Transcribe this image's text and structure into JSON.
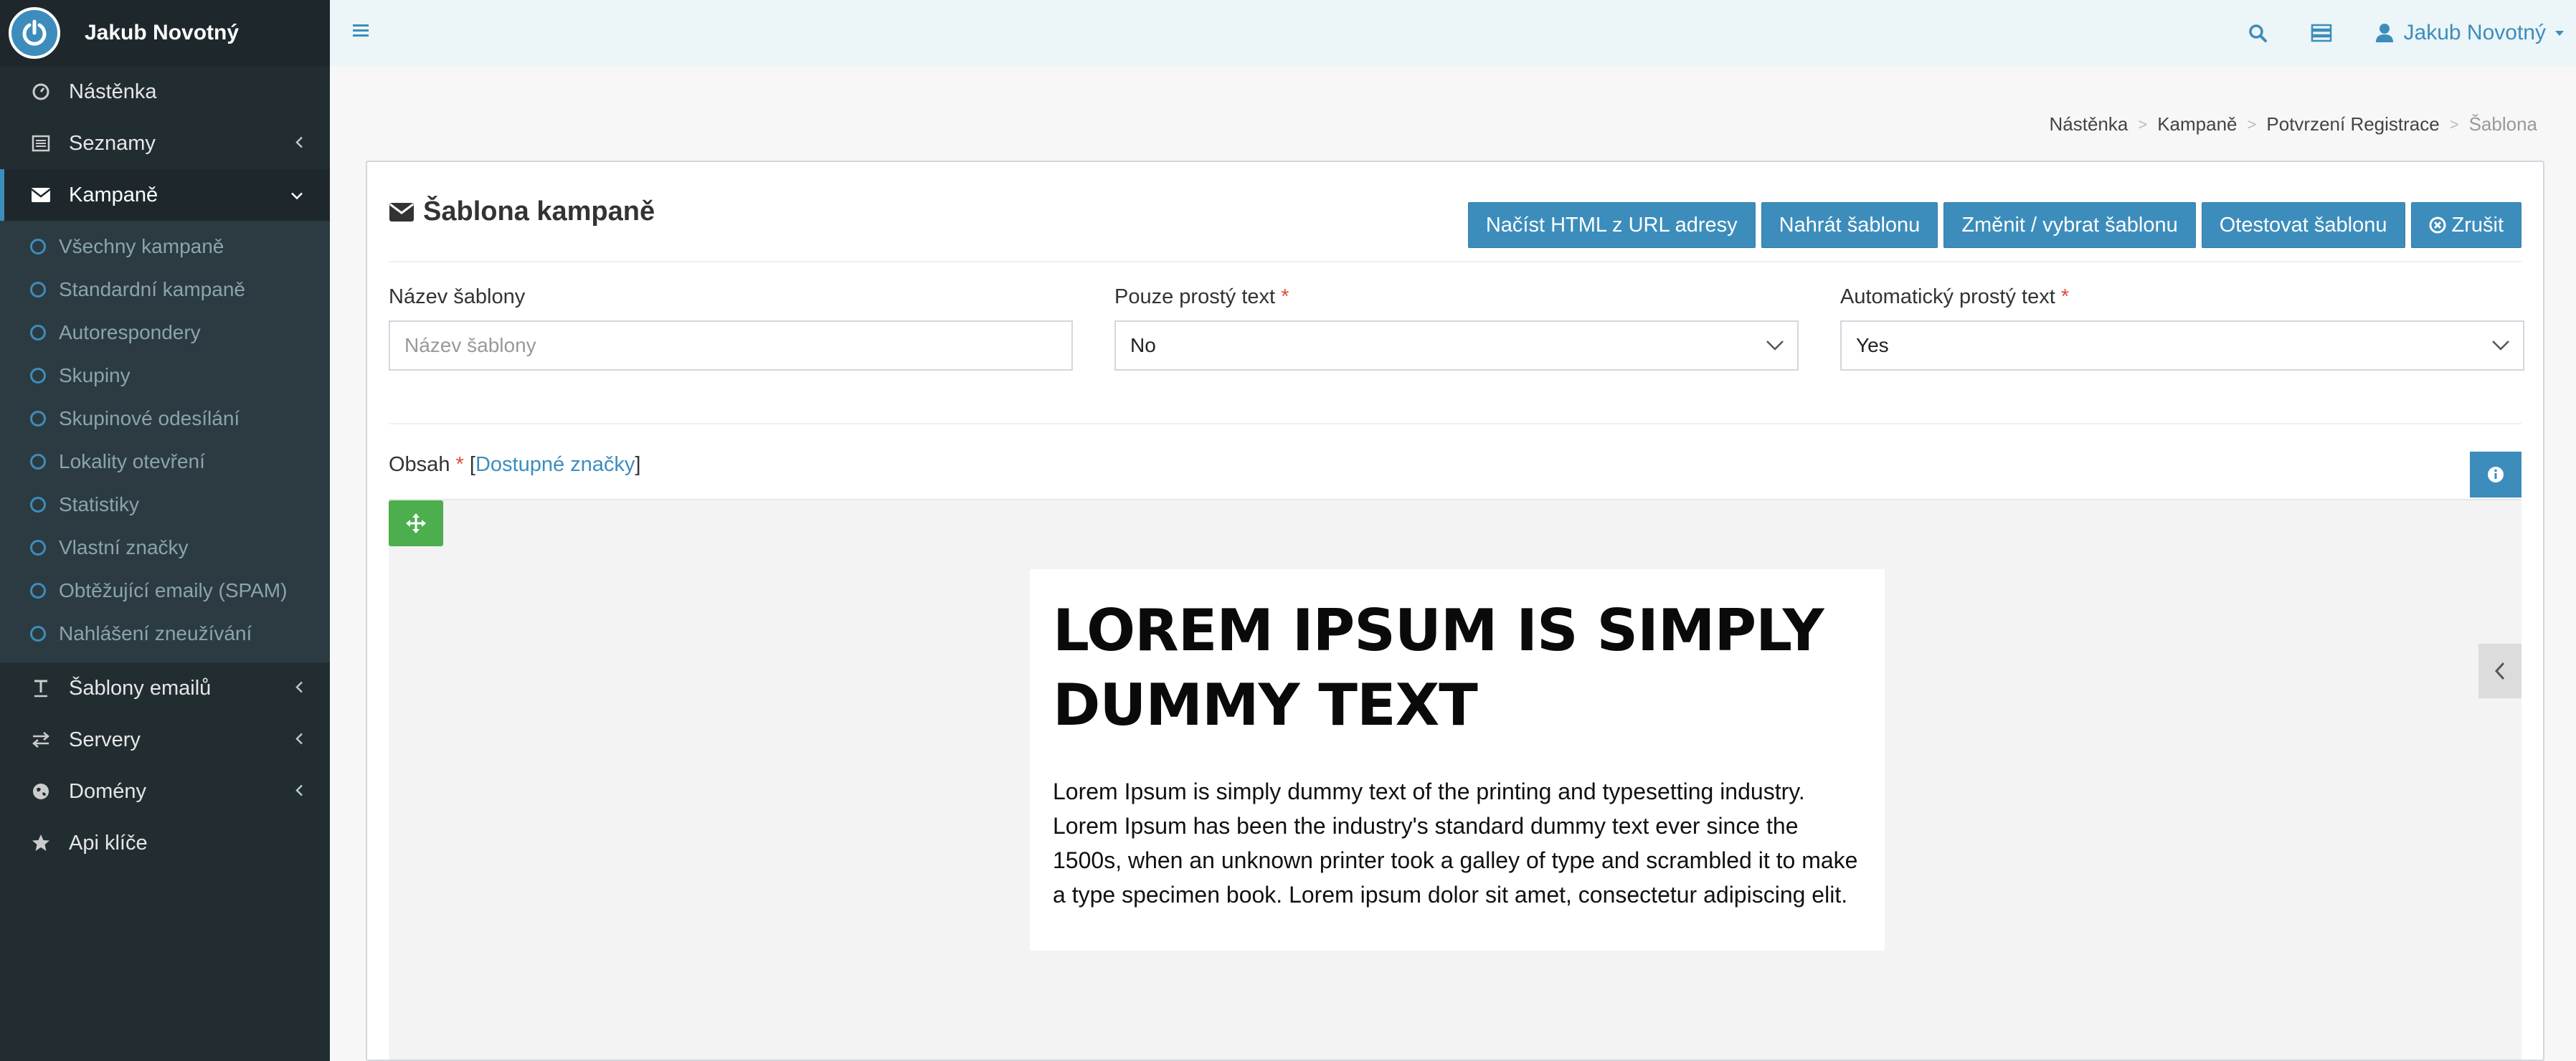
{
  "brand": {
    "name": "Jakub Novotný"
  },
  "sidebar": {
    "items": [
      {
        "label": "Nástěnka"
      },
      {
        "label": "Seznamy"
      },
      {
        "label": "Kampaně"
      }
    ],
    "submenu": [
      "Všechny kampaně",
      "Standardní kampaně",
      "Autorespondery",
      "Skupiny",
      "Skupinové odesílání",
      "Lokality otevření",
      "Statistiky",
      "Vlastní značky",
      "Obtěžující emaily (SPAM)",
      "Nahlášení zneužívání"
    ],
    "items_after": [
      {
        "label": "Šablony emailů"
      },
      {
        "label": "Servery"
      },
      {
        "label": "Domény"
      },
      {
        "label": "Api klíče"
      }
    ]
  },
  "header": {
    "user": "Jakub Novotný"
  },
  "breadcrumb": [
    "Nástěnka",
    "Kampaně",
    "Potvrzení Registrace",
    "Šablona"
  ],
  "page": {
    "title": "Šablona kampaně",
    "buttons": {
      "load_url": "Načíst HTML z URL adresy",
      "upload": "Nahrát šablonu",
      "change": "Změnit / vybrat šablonu",
      "test": "Otestovat šablonu",
      "cancel": "Zrušit"
    },
    "fields": {
      "name_label": "Název šablony",
      "name_placeholder": "Název šablony",
      "plain_label": "Pouze prostý text",
      "plain_value": "No",
      "auto_label": "Automatický prostý text",
      "auto_value": "Yes",
      "required_mark": "*"
    },
    "content": {
      "label": "Obsah",
      "required_mark": "*",
      "tags_link": "Dostupné značky"
    }
  },
  "email": {
    "title": "LOREM IPSUM IS SIMPLY DUMMY TEXT",
    "body": "Lorem Ipsum is simply dummy text of the printing and typesetting industry. Lorem Ipsum has been the industry's standard dummy text ever since the 1500s, when an unknown printer took a galley of type and scrambled it to make a type specimen book. Lorem ipsum dolor sit amet, consectetur adipiscing elit."
  },
  "colors": {
    "accent": "#3c8dbc",
    "sidebar": "#222d32",
    "success": "#4cae4c",
    "required": "#dd4b39"
  }
}
